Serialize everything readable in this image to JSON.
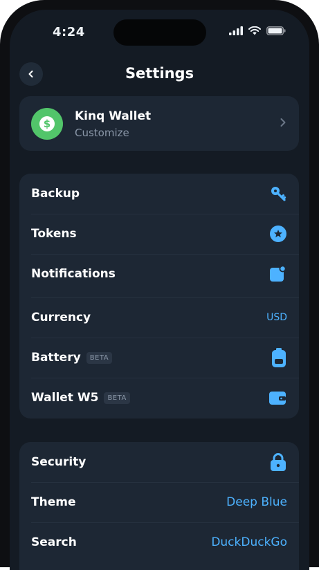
{
  "status": {
    "time": "4:24"
  },
  "header": {
    "title": "Settings"
  },
  "wallet": {
    "name": "Kinq Wallet",
    "subtitle": "Customize"
  },
  "settings_group_1": [
    {
      "label": "Backup",
      "icon": "key-icon"
    },
    {
      "label": "Tokens",
      "icon": "star-circle-icon"
    },
    {
      "label": "Notifications",
      "icon": "notification-icon"
    },
    {
      "label": "Currency",
      "value": "USD"
    },
    {
      "label": "Battery",
      "badge": "BETA",
      "icon": "battery-icon"
    },
    {
      "label": "Wallet W5",
      "badge": "BETA",
      "icon": "wallet-icon"
    }
  ],
  "settings_group_2": [
    {
      "label": "Security",
      "icon": "lock-icon"
    },
    {
      "label": "Theme",
      "value": "Deep Blue"
    },
    {
      "label": "Search",
      "value": "DuckDuckGo"
    }
  ],
  "colors": {
    "accent": "#4db2ff",
    "background": "#141b24",
    "card": "#1d2734",
    "wallet_avatar": "#52c56a"
  }
}
